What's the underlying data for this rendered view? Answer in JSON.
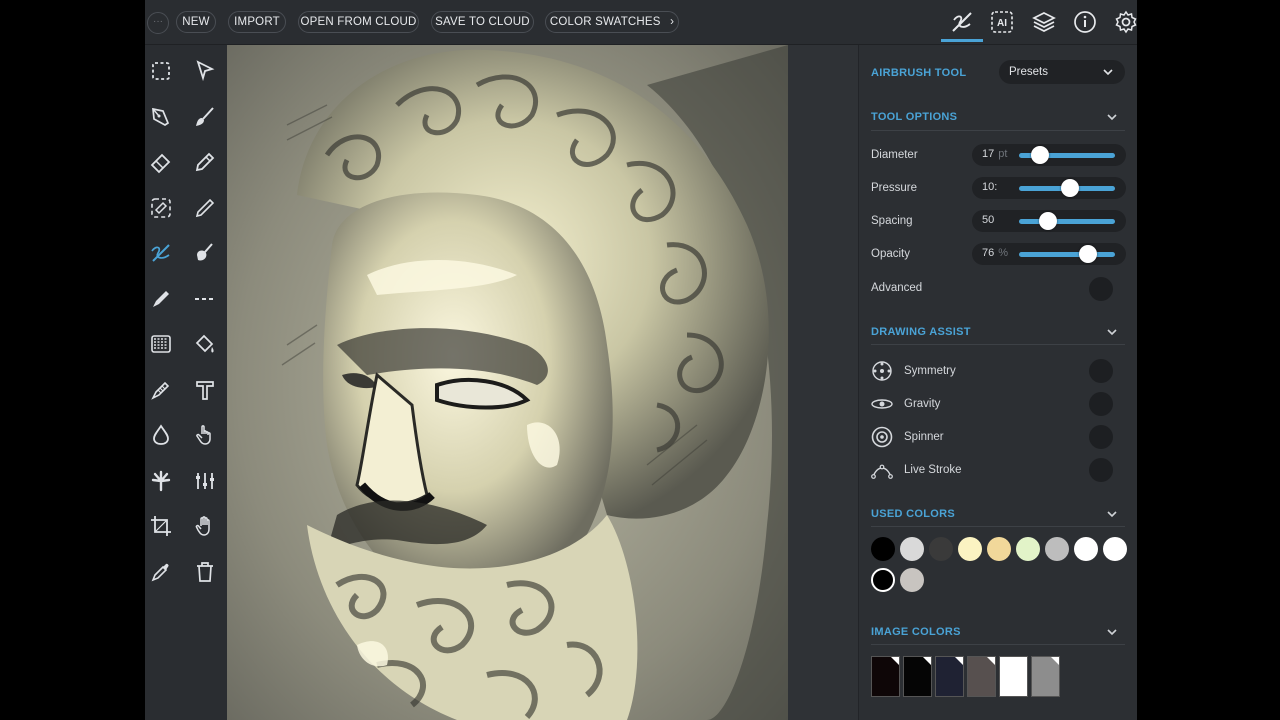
{
  "topbar": {
    "menu_dots": "···",
    "new_label": "NEW",
    "import_label": "IMPORT",
    "open_cloud_label": "OPEN FROM CLOUD",
    "save_cloud_label": "SAVE TO CLOUD",
    "swatches_label": "COLOR SWATCHES",
    "swatches_chevron": "›",
    "icons": [
      "brush-tool-icon",
      "ai-icon",
      "layers-icon",
      "info-icon",
      "settings-gear-icon"
    ],
    "accent": "#4aa3d6"
  },
  "left_tools": [
    "marquee-select-icon",
    "pointer-select-icon",
    "pen-nib-icon",
    "paint-brush-icon",
    "eraser-icon",
    "pencil-icon",
    "transform-icon",
    "fine-pencil-icon",
    "airbrush-icon",
    "smudge-icon",
    "marker-icon",
    "dashed-line-icon",
    "pattern-fill-icon",
    "paint-bucket-icon",
    "texture-brush-icon",
    "text-tool-icon",
    "water-drop-icon",
    "touch-hand-icon",
    "spray-brush-icon",
    "adjustments-icon",
    "crop-icon",
    "pan-hand-icon",
    "eyedropper-icon",
    "trash-icon"
  ],
  "panel": {
    "tool_name": "AIRBRUSH TOOL",
    "presets_label": "Presets",
    "tool_options_title": "TOOL OPTIONS",
    "options": [
      {
        "label": "Diameter",
        "value": "17",
        "unit": "pt",
        "level": 0.22
      },
      {
        "label": "Pressure",
        "value": "10:",
        "unit": "",
        "level": 0.53
      },
      {
        "label": "Spacing",
        "value": "50",
        "unit": "",
        "level": 0.3
      },
      {
        "label": "Opacity",
        "value": "76",
        "unit": "%",
        "level": 0.72
      }
    ],
    "advanced_label": "Advanced",
    "drawing_assist_title": "DRAWING ASSIST",
    "assists": [
      {
        "label": "Symmetry",
        "icon": "symmetry-icon"
      },
      {
        "label": "Gravity",
        "icon": "gravity-icon"
      },
      {
        "label": "Spinner",
        "icon": "spinner-icon"
      },
      {
        "label": "Live Stroke",
        "icon": "live-stroke-icon"
      }
    ],
    "used_colors_title": "USED COLORS",
    "used_colors": [
      "#000000",
      "#d9d9d9",
      "#3a3a3a",
      "#fbf3c2",
      "#f1d89a",
      "#e2f3c8",
      "#bdbdbd",
      "#ffffff",
      "#ffffff",
      "#000000",
      "#c8c4c0"
    ],
    "image_colors_title": "IMAGE COLORS",
    "image_colors": [
      "#0e0607",
      "#050505",
      "#1f2233",
      "#57504f",
      "#ffffff",
      "#8d8d8d"
    ]
  }
}
